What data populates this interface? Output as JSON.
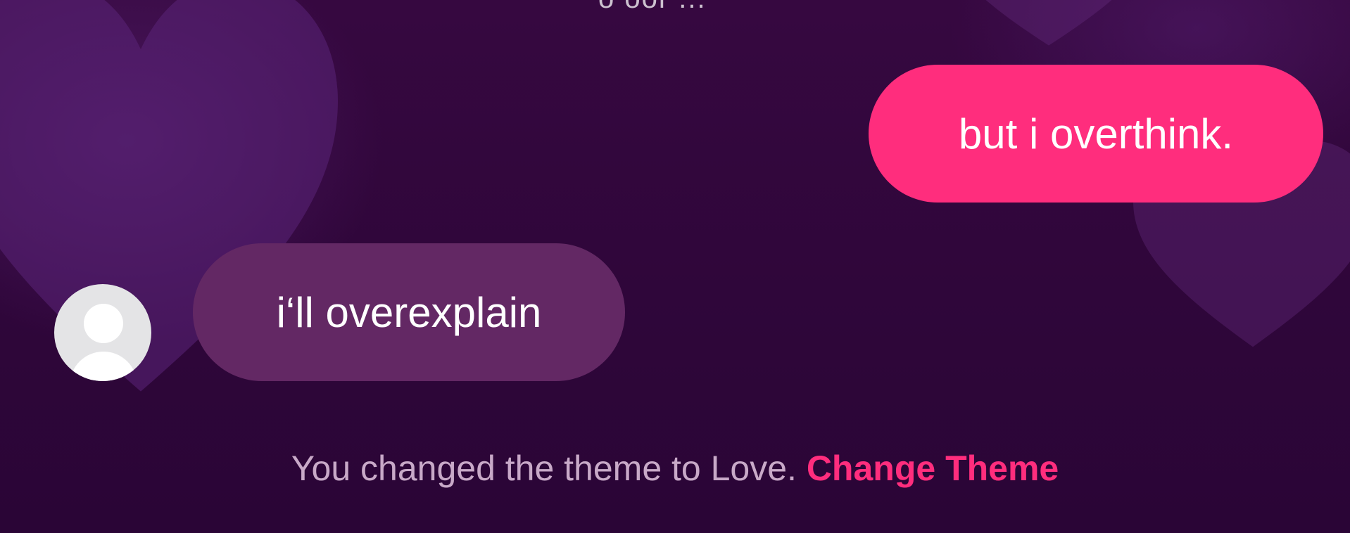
{
  "thread": {
    "previous_message_fragment": "o oor ...",
    "messages": [
      {
        "direction": "outgoing",
        "text": "but i overthink."
      },
      {
        "direction": "incoming",
        "text": "i‘ll overexplain"
      }
    ],
    "system_notice": {
      "text": "You changed the theme to Love.",
      "link_label": "Change Theme"
    }
  },
  "theme": {
    "name": "Love",
    "background": "#30063c",
    "outgoing_bubble": "#ff2d7d",
    "incoming_bubble": "#632864",
    "link_color": "#ff2d7d",
    "decoration": "heart-icon"
  },
  "avatar": {
    "icon": "default-avatar-icon"
  }
}
